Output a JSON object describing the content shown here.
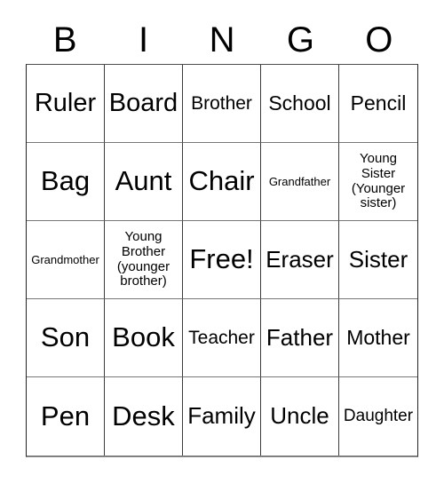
{
  "card": {
    "title": "BINGO",
    "header_letters": [
      "B",
      "I",
      "N",
      "G",
      "O"
    ],
    "free_space_label": "Free!",
    "rows": [
      [
        {
          "label": "Ruler",
          "size": "fs-xl"
        },
        {
          "label": "Board",
          "size": "fs-xl"
        },
        {
          "label": "Brother",
          "size": "fs-s"
        },
        {
          "label": "School",
          "size": "fs-m"
        },
        {
          "label": "Pencil",
          "size": "fs-m"
        }
      ],
      [
        {
          "label": "Bag",
          "size": "fs-xxl"
        },
        {
          "label": "Aunt",
          "size": "fs-xxl"
        },
        {
          "label": "Chair",
          "size": "fs-xxl"
        },
        {
          "label": "Grandfather",
          "size": "fs-tiny"
        },
        {
          "label": "Young\nSister\n(Younger\nsister)",
          "size": "fs-xxs"
        }
      ],
      [
        {
          "label": "Grandmother",
          "size": "fs-tiny"
        },
        {
          "label": "Young\nBrother\n(younger\nbrother)",
          "size": "fs-xxs"
        },
        {
          "label": "Free!",
          "size": "fs-xxl"
        },
        {
          "label": "Eraser",
          "size": "fs-l"
        },
        {
          "label": "Sister",
          "size": "fs-l"
        }
      ],
      [
        {
          "label": "Son",
          "size": "fs-xxl"
        },
        {
          "label": "Book",
          "size": "fs-xxl"
        },
        {
          "label": "Teacher",
          "size": "fs-s"
        },
        {
          "label": "Father",
          "size": "fs-l"
        },
        {
          "label": "Mother",
          "size": "fs-m"
        }
      ],
      [
        {
          "label": "Pen",
          "size": "fs-xxl"
        },
        {
          "label": "Desk",
          "size": "fs-xxl"
        },
        {
          "label": "Family",
          "size": "fs-l"
        },
        {
          "label": "Uncle",
          "size": "fs-l"
        },
        {
          "label": "Daughter",
          "size": "fs-xs"
        }
      ]
    ]
  },
  "colors": {
    "background": "#ffffff",
    "text": "#000000",
    "grid_line": "#3a3a3a",
    "grid_shadow": "#808080"
  }
}
